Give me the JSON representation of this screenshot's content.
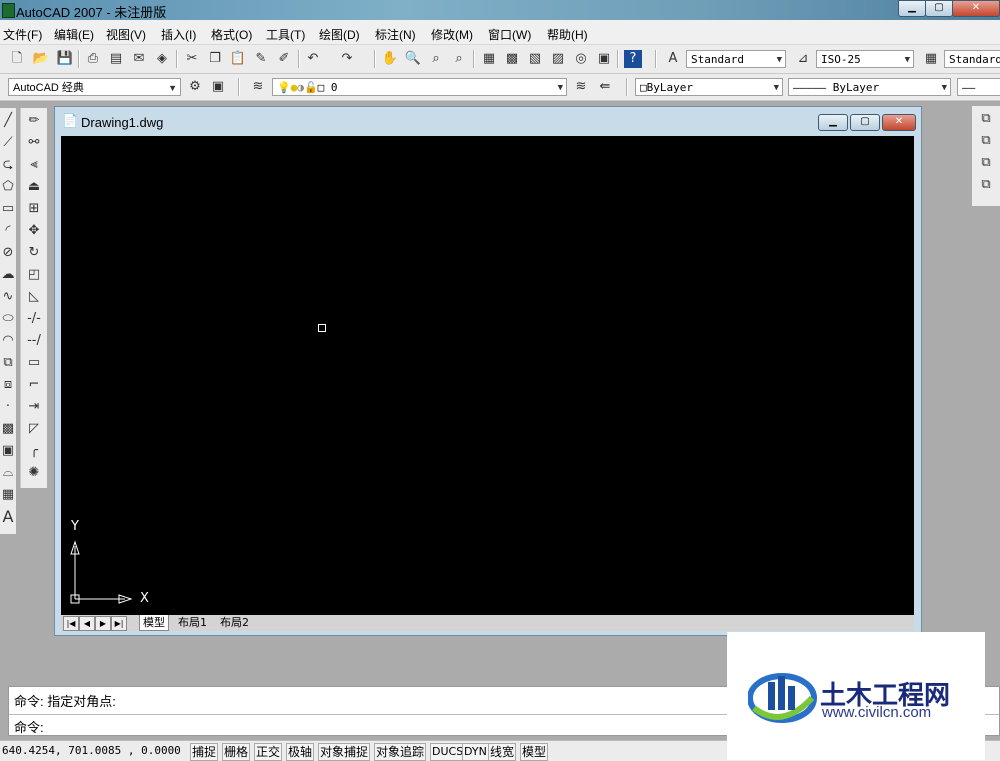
{
  "window": {
    "title": "AutoCAD 2007 - 未注册版"
  },
  "menu": [
    "文件(F)",
    "编辑(E)",
    "视图(V)",
    "插入(I)",
    "格式(O)",
    "工具(T)",
    "绘图(D)",
    "标注(N)",
    "修改(M)",
    "窗口(W)",
    "帮助(H)"
  ],
  "toolbar1": {
    "text_style": "Standard",
    "dim_style": "ISO-25",
    "table_style": "Standard"
  },
  "toolbar2": {
    "workspace": "AutoCAD 经典",
    "layer": "0",
    "color": "ByLayer",
    "linetype": "ByLayer"
  },
  "drawing": {
    "title": "Drawing1.dwg",
    "ucs_x": "X",
    "ucs_y": "Y",
    "tabs": [
      "模型",
      "布局1",
      "布局2"
    ]
  },
  "command": {
    "line1": "命令: 指定对角点:",
    "line2": "命令:"
  },
  "status": {
    "coords": "640.4254,  701.0085 , 0.0000",
    "buttons": [
      "捕捉",
      "栅格",
      "正交",
      "极轴",
      "对象捕捉",
      "对象追踪",
      "DUCS",
      "DYN",
      "线宽",
      "模型"
    ]
  },
  "watermark": {
    "text": "土木工程网",
    "url": "www.civilcn.com"
  },
  "icons": {
    "draw_left": [
      "line-icon",
      "xline-icon",
      "polyline-icon",
      "polygon-icon",
      "rectangle-icon",
      "arc-icon",
      "circle-icon",
      "revcloud-icon",
      "spline-icon",
      "ellipse-icon",
      "ellipse-arc-icon",
      "insert-block-icon",
      "make-block-icon",
      "point-icon",
      "hatch-icon",
      "gradient-icon",
      "region-icon",
      "table-icon",
      "mtext-icon"
    ]
  }
}
